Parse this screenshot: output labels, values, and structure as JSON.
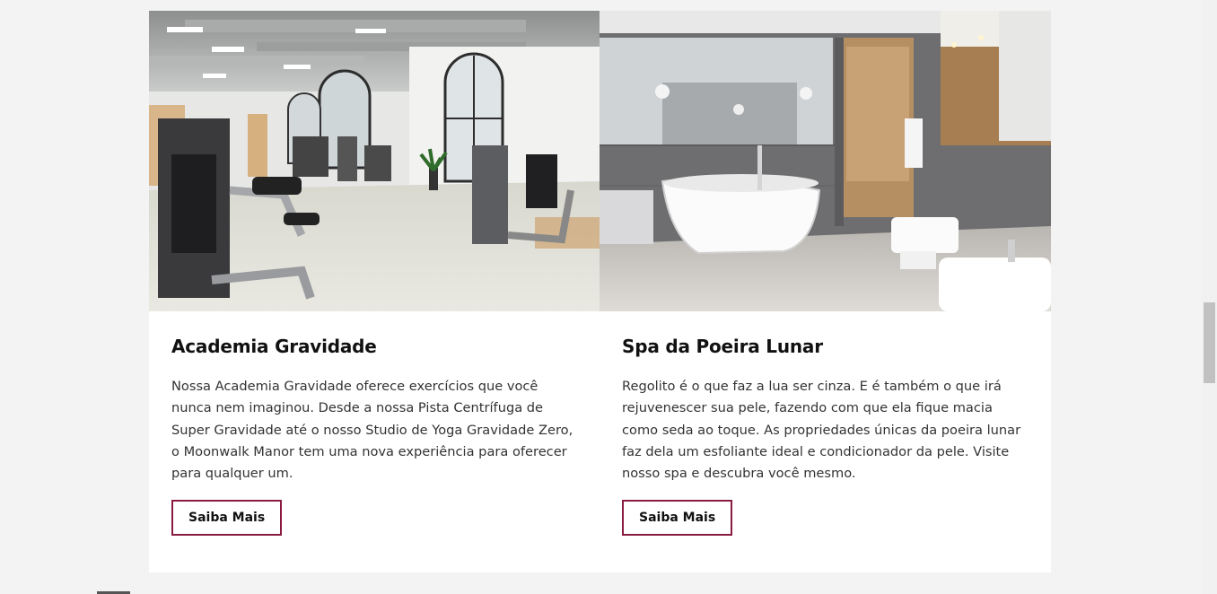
{
  "cards": [
    {
      "title": "Academia Gravidade",
      "text": "Nossa Academia Gravidade oferece exercícios que você nunca nem imaginou. Desde a nossa Pista Centrífuga de Super Gravidade até o nosso Studio de Yoga Gravidade Zero, o Moonwalk Manor tem uma nova experiência para oferecer para qualquer um.",
      "button_label": "Saiba Mais"
    },
    {
      "title": "Spa da Poeira Lunar",
      "text": "Regolito é o que faz a lua ser cinza. E é também o que irá rejuvenescer sua pele, fazendo com que ela fique macia como seda ao toque. As propriedades únicas da poeira lunar faz dela um esfoliante ideal e condicionador da pele. Visite nosso spa e descubra você mesmo.",
      "button_label": "Saiba Mais"
    }
  ],
  "colors": {
    "button_border": "#8a1c3f",
    "page_background": "#f3f3f3",
    "card_background": "#ffffff"
  }
}
